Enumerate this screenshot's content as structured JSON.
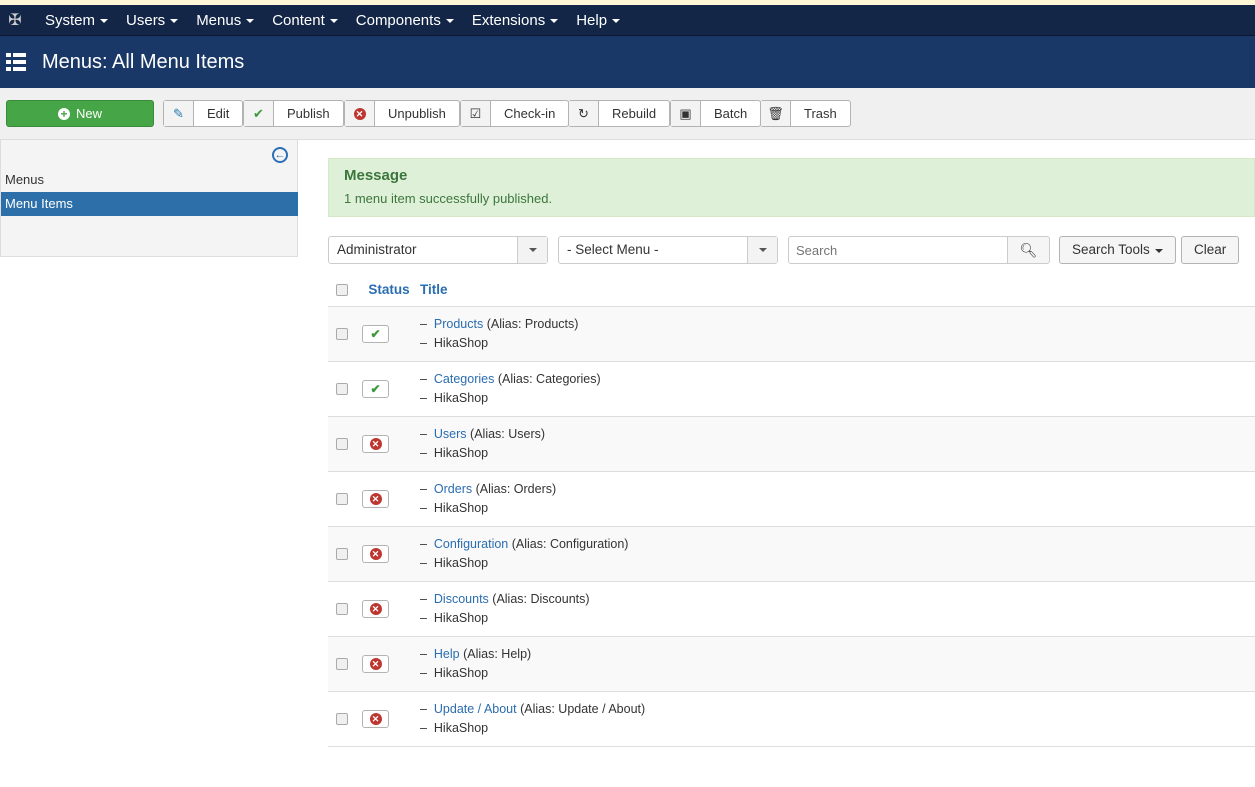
{
  "nav": [
    "System",
    "Users",
    "Menus",
    "Content",
    "Components",
    "Extensions",
    "Help"
  ],
  "page_title": "Menus: All Menu Items",
  "toolbar": {
    "new": "New",
    "edit": "Edit",
    "publish": "Publish",
    "unpublish": "Unpublish",
    "checkin": "Check-in",
    "rebuild": "Rebuild",
    "batch": "Batch",
    "trash": "Trash"
  },
  "sidebar": {
    "items": [
      "Menus",
      "Menu Items"
    ]
  },
  "message": {
    "heading": "Message",
    "text": "1 menu item successfully published."
  },
  "filters": {
    "client": "Administrator",
    "menu": "- Select Menu -",
    "search_placeholder": "Search",
    "search_tools": "Search Tools",
    "clear": "Clear"
  },
  "table": {
    "headers": {
      "status": "Status",
      "title": "Title"
    },
    "rows": [
      {
        "title": "Products",
        "alias": "(Alias: Products)",
        "menu": "HikaShop",
        "published": true
      },
      {
        "title": "Categories",
        "alias": "(Alias: Categories)",
        "menu": "HikaShop",
        "published": true
      },
      {
        "title": "Users",
        "alias": "(Alias: Users)",
        "menu": "HikaShop",
        "published": false
      },
      {
        "title": "Orders",
        "alias": "(Alias: Orders)",
        "menu": "HikaShop",
        "published": false
      },
      {
        "title": "Configuration",
        "alias": "(Alias: Configuration)",
        "menu": "HikaShop",
        "published": false
      },
      {
        "title": "Discounts",
        "alias": "(Alias: Discounts)",
        "menu": "HikaShop",
        "published": false
      },
      {
        "title": "Help",
        "alias": "(Alias: Help)",
        "menu": "HikaShop",
        "published": false
      },
      {
        "title": "Update / About",
        "alias": "(Alias: Update / About)",
        "menu": "HikaShop",
        "published": false
      }
    ]
  },
  "colors": {
    "navbar": "#132648",
    "header": "#1a3867",
    "new_button": "#46a546",
    "link": "#2a6db0"
  }
}
